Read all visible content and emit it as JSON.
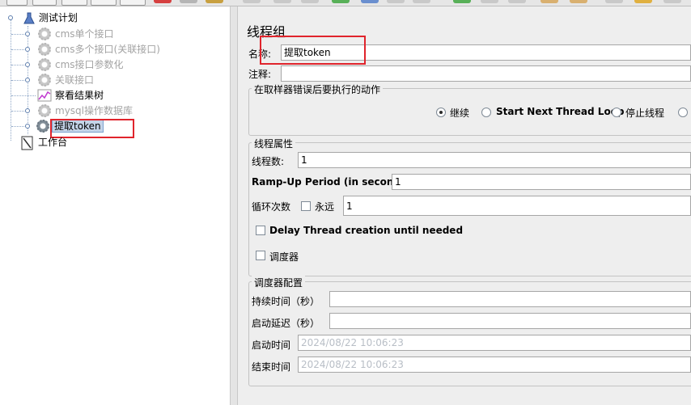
{
  "tree": {
    "root": "测试计划",
    "items": [
      {
        "label": "cms单个接口",
        "disabled": true
      },
      {
        "label": "cms多个接口(关联接口)",
        "disabled": true
      },
      {
        "label": "cms接口参数化",
        "disabled": true
      },
      {
        "label": "关联接口",
        "disabled": true
      },
      {
        "label": "察看结果树",
        "disabled": false
      },
      {
        "label": "mysql操作数据库",
        "disabled": true
      },
      {
        "label": "提取token",
        "selected": true
      }
    ],
    "workbench": "工作台"
  },
  "panel": {
    "title": "线程组",
    "name_label": "名称:",
    "name_value": "提取token",
    "comment_label": "注释:",
    "comment_value": "",
    "error_action": {
      "legend": "在取样器错误后要执行的动作",
      "options": [
        "继续",
        "Start Next Thread Loop",
        "停止线程"
      ],
      "selected": "继续"
    },
    "thread_props": {
      "legend": "线程属性",
      "threads_label": "线程数:",
      "threads_value": "1",
      "rampup_label": "Ramp-Up Period (in seconds):",
      "rampup_value": "1",
      "loop_label": "循环次数",
      "forever_label": "永远",
      "loop_value": "1",
      "delay_label": "Delay Thread creation until needed",
      "scheduler_label": "调度器"
    },
    "scheduler": {
      "legend": "调度器配置",
      "duration_label": "持续时间（秒）",
      "duration_value": "",
      "delay_label": "启动延迟（秒）",
      "delay_value": "",
      "start_label": "启动时间",
      "start_value": "2024/08/22 10:06:23",
      "end_label": "结束时间",
      "end_value": "2024/08/22 10:06:23"
    }
  }
}
